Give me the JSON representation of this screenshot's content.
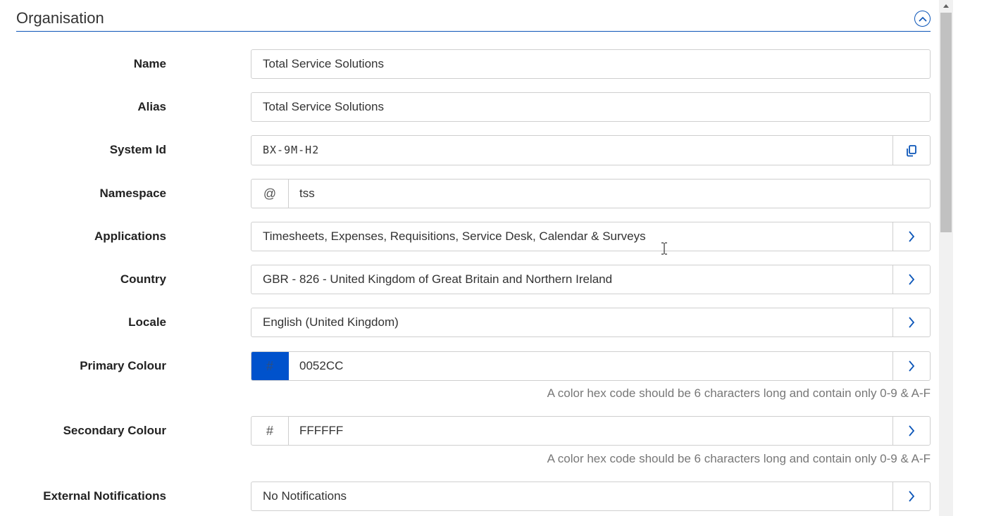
{
  "section": {
    "title": "Organisation"
  },
  "fields": {
    "name": {
      "label": "Name",
      "value": "Total Service Solutions"
    },
    "alias": {
      "label": "Alias",
      "value": "Total Service Solutions"
    },
    "system_id": {
      "label": "System Id",
      "value": "BX-9M-H2",
      "action_icon": "copy-icon"
    },
    "namespace": {
      "label": "Namespace",
      "prefix": "@",
      "value": "tss"
    },
    "applications": {
      "label": "Applications",
      "value": "Timesheets, Expenses, Requisitions, Service Desk, Calendar & Surveys",
      "action_icon": "chevron-right-icon"
    },
    "country": {
      "label": "Country",
      "value": "GBR - 826 - United Kingdom of Great Britain and Northern Ireland",
      "action_icon": "chevron-right-icon"
    },
    "locale": {
      "label": "Locale",
      "value": "English (United Kingdom)",
      "action_icon": "chevron-right-icon"
    },
    "primary_colour": {
      "label": "Primary Colour",
      "prefix": "#",
      "value": "0052CC",
      "swatch": "#0052CC",
      "help": "A color hex code should be 6 characters long and contain only 0-9 & A-F"
    },
    "secondary_colour": {
      "label": "Secondary Colour",
      "prefix": "#",
      "value": "FFFFFF",
      "swatch": "#FFFFFF",
      "help": "A color hex code should be 6 characters long and contain only 0-9 & A-F"
    },
    "external_notifications": {
      "label": "External Notifications",
      "value": "No Notifications",
      "action_icon": "chevron-right-icon"
    }
  },
  "colors": {
    "accent": "#0B55B8",
    "border": "#CFCFCF",
    "help_text": "#777777"
  }
}
